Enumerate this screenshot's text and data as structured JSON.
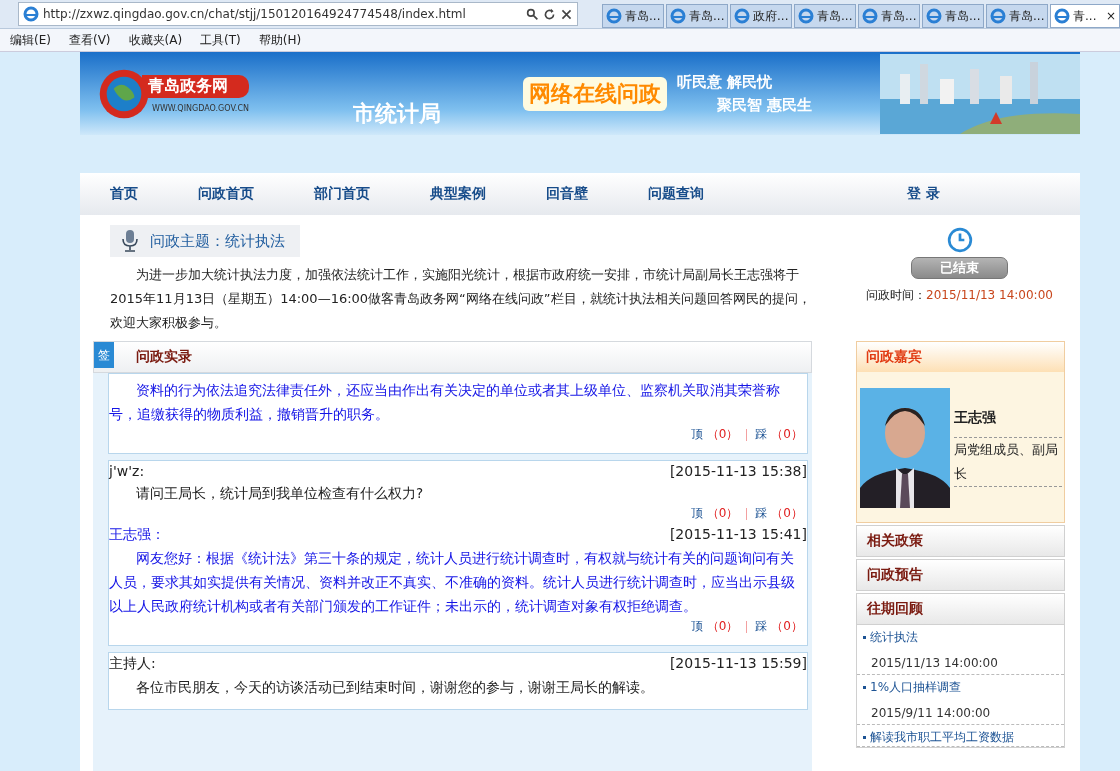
{
  "browser": {
    "url": "http://zxwz.qingdao.gov.cn/chat/stjj/150120164924774548/index.html",
    "tabs": [
      {
        "label": "青岛...",
        "selected": false
      },
      {
        "label": "青岛...",
        "selected": false
      },
      {
        "label": "政府...",
        "selected": false
      },
      {
        "label": "青岛...",
        "selected": false
      },
      {
        "label": "青岛...",
        "selected": false
      },
      {
        "label": "青岛...",
        "selected": false
      },
      {
        "label": "青岛...",
        "selected": false
      },
      {
        "label": "青...",
        "selected": true
      }
    ],
    "close_tab": "×",
    "menu": [
      "编辑(E)",
      "查看(V)",
      "收藏夹(A)",
      "工具(T)",
      "帮助(H)"
    ]
  },
  "banner": {
    "logo_text": "青岛政务网",
    "logo_url": "WWW.QINGDAO.GOV.CN",
    "department": "市统计局",
    "slogan": "网络在线问政",
    "motto_1": "听民意 解民忧",
    "motto_2": "聚民智  惠民生"
  },
  "nav": {
    "items": [
      "首页",
      "问政首页",
      "部门首页",
      "典型案例",
      "回音壁",
      "问题查询"
    ],
    "login": "登  录"
  },
  "topic": {
    "title": "问政主题：统计执法",
    "intro": "为进一步加大统计执法力度，加强依法统计工作，实施阳光统计，根据市政府统一安排，市统计局副局长王志强将于2015年11月13日（星期五）14:00—16:00做客青岛政务网“网络在线问政”栏目，就统计执法相关问题回答网民的提问，欢迎大家积极参与。"
  },
  "status": {
    "label": "已结束",
    "time_label": "问政时间：",
    "time": "2015/11/13 14:00:00"
  },
  "record": {
    "badge": "签",
    "title": "问政实录",
    "cards": [
      {
        "entries": [
          {
            "kind": "answer",
            "text": "资料的行为依法追究法律责任外，还应当由作出有关决定的单位或者其上级单位、监察机关取消其荣誉称号，追缴获得的物质利益，撤销晋升的职务。",
            "votes": [
              {
                "label": "顶",
                "count": "（0）"
              },
              {
                "label": "踩",
                "count": "（0）"
              }
            ]
          }
        ]
      },
      {
        "entries": [
          {
            "kind": "question",
            "author": "j'w'z:",
            "time": "[2015-11-13 15:38]",
            "text": "请问王局长，统计局到我单位检查有什么权力?",
            "votes": [
              {
                "label": "顶",
                "count": "（0）"
              },
              {
                "label": "踩",
                "count": "（0）"
              }
            ]
          },
          {
            "kind": "answer",
            "author": "王志强：",
            "time": "[2015-11-13 15:41]",
            "text": "网友您好：根据《统计法》第三十条的规定，统计人员进行统计调查时，有权就与统计有关的问题询问有关人员，要求其如实提供有关情况、资料并改正不真实、不准确的资料。统计人员进行统计调查时，应当出示县级以上人民政府统计机构或者有关部门颁发的工作证件；未出示的，统计调查对象有权拒绝调查。",
            "votes": [
              {
                "label": "顶",
                "count": "（0）"
              },
              {
                "label": "踩",
                "count": "（0）"
              }
            ]
          }
        ]
      },
      {
        "entries": [
          {
            "kind": "host",
            "author": "主持人:",
            "time": "[2015-11-13 15:59]",
            "text": "各位市民朋友，今天的访谈活动已到结束时间，谢谢您的参与，谢谢王局长的解读。"
          }
        ]
      }
    ]
  },
  "sidebar": {
    "guest_title": "问政嘉宾",
    "guest_name": "王志强",
    "guest_role": "局党组成员、副局长",
    "sections": [
      "相关政策",
      "问政预告"
    ],
    "history_title": "往期回顾",
    "history": [
      {
        "title": "统计执法",
        "time": "2015/11/13 14:00:00"
      },
      {
        "title": "1%人口抽样调查",
        "time": "2015/9/11 14:00:00"
      },
      {
        "title": "解读我市职工平均工资数据"
      }
    ]
  }
}
